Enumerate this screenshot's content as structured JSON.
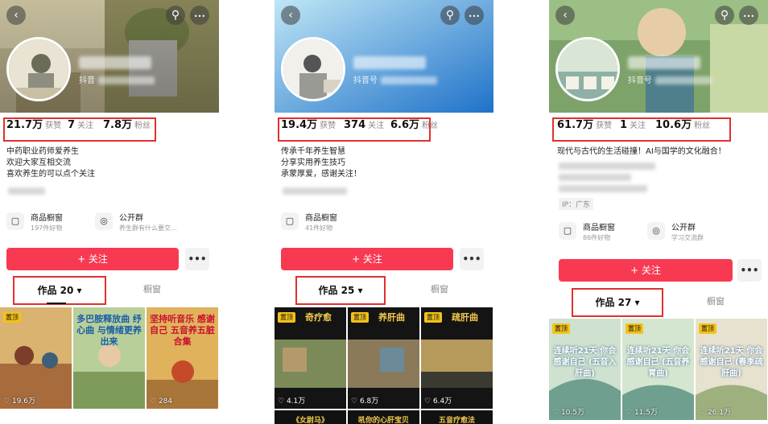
{
  "icons": {
    "back": "‹",
    "search": "⚲",
    "more": "•••",
    "store": "▢",
    "group": "◎",
    "heart": "♡"
  },
  "profiles": [
    {
      "id_prefix": "抖音",
      "stats": {
        "likes": "21.7万",
        "likes_label": "获赞",
        "following": "7",
        "following_label": "关注",
        "fans": "7.8万",
        "fans_label": "粉丝"
      },
      "bio": [
        "中药职业药师爱养生",
        "欢迎大家互相交流",
        "喜欢养生的可以点个关注"
      ],
      "features": [
        {
          "title": "商品橱窗",
          "sub": "197件好物"
        },
        {
          "title": "公开群",
          "sub": "养生群有什么要交..."
        }
      ],
      "follow_label": "+ 关注",
      "more_label": "•••",
      "tabs": {
        "works": "作品 20 ▾",
        "shop": "橱窗"
      },
      "thumbs": [
        {
          "text": "...",
          "likes": "19.6万",
          "pinned": true,
          "pin_label": "置顶"
        },
        {
          "text": "多巴胺释放曲 纾心曲 与情绪更养出来",
          "likes": "",
          "pinned": false,
          "pin_label": ""
        },
        {
          "text": "坚持听音乐 感谢自己 五音养五脏 合集",
          "likes": "284",
          "pinned": false,
          "pin_label": ""
        }
      ]
    },
    {
      "id_prefix": "抖音号",
      "stats": {
        "likes": "19.4万",
        "likes_label": "获赞",
        "following": "374",
        "following_label": "关注",
        "fans": "6.6万",
        "fans_label": "粉丝"
      },
      "bio": [
        "传承千年养生智慧",
        "分享实用养生技巧",
        "承蒙厚爱，感谢关注！"
      ],
      "features": [
        {
          "title": "商品橱窗",
          "sub": "41件好物"
        }
      ],
      "follow_label": "+ 关注",
      "more_label": "•••",
      "tabs": {
        "works": "作品 25 ▾",
        "shop": "橱窗"
      },
      "thumbs": [
        {
          "text": "奇疗愈",
          "likes": "4.1万",
          "pinned": true,
          "pin_label": "置顶"
        },
        {
          "text": "养肝曲",
          "likes": "6.8万",
          "pinned": true,
          "pin_label": "置顶"
        },
        {
          "text": "疏肝曲",
          "likes": "6.4万",
          "pinned": true,
          "pin_label": "置顶"
        }
      ],
      "row2": [
        "《女尉马》",
        "吼你的心肝宝贝",
        "五音疗愈法"
      ]
    },
    {
      "id_prefix": "抖音号",
      "stats": {
        "likes": "61.7万",
        "likes_label": "获赞",
        "following": "1",
        "following_label": "关注",
        "fans": "10.6万",
        "fans_label": "粉丝"
      },
      "bio": [
        "现代与古代的生活碰撞！AI与国学的文化融合！"
      ],
      "ip": "IP：广东",
      "features": [
        {
          "title": "商品橱窗",
          "sub": "86件好物"
        },
        {
          "title": "公开群",
          "sub": "学习交流群"
        }
      ],
      "follow_label": "+ 关注",
      "more_label": "•••",
      "tabs": {
        "works": "作品 27 ▾",
        "shop": "橱窗"
      },
      "thumbs": [
        {
          "text": "连续听21天 你会感谢自己 (五音入肝曲)",
          "likes": "10.5万",
          "pinned": true,
          "pin_label": "置顶"
        },
        {
          "text": "连续听21天 你会感谢自己 (五音养胃曲)",
          "likes": "11.5万",
          "pinned": true,
          "pin_label": "置顶"
        },
        {
          "text": "连续听21天 你会感谢自己 (春季疏肝曲)",
          "likes": "26.1万",
          "pinned": true,
          "pin_label": "置顶"
        }
      ]
    }
  ]
}
